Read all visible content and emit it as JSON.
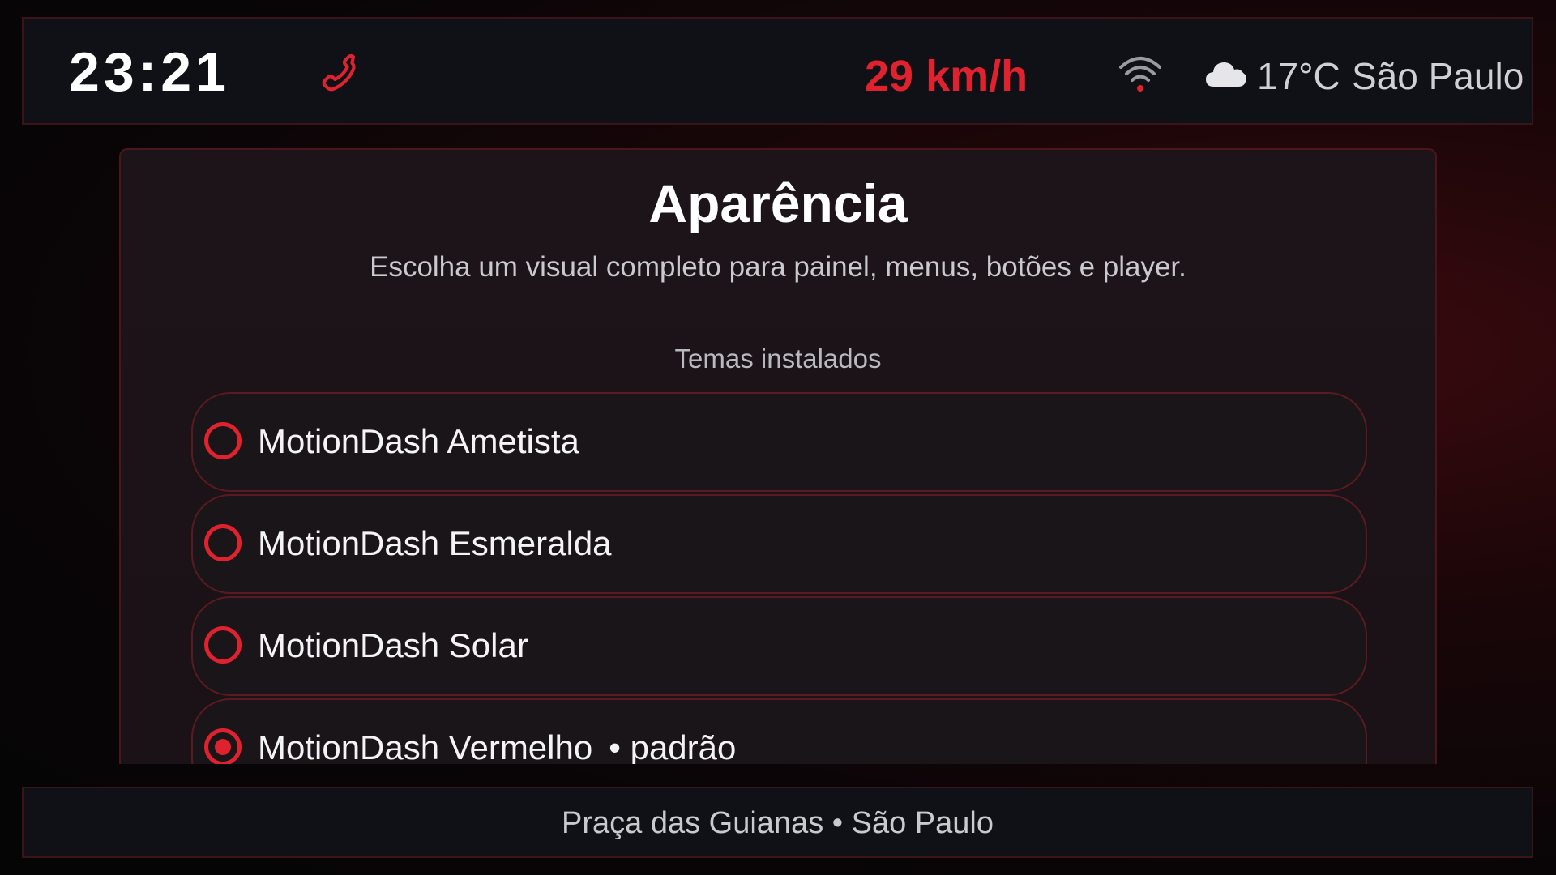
{
  "status_bar": {
    "time": "23:21",
    "speed": "29 km/h",
    "temperature": "17°C",
    "city": "São Paulo",
    "icons": [
      "phone-icon",
      "wifi-icon",
      "cloud-icon"
    ],
    "accent_color": "#e0222e"
  },
  "appearance": {
    "title": "Aparência",
    "subtitle": "Escolha um visual completo para painel, menus, botões e player.",
    "section_label": "Temas instalados",
    "themes": [
      {
        "name": "MotionDash Ametista",
        "selected": false,
        "tag": ""
      },
      {
        "name": "MotionDash Esmeralda",
        "selected": false,
        "tag": ""
      },
      {
        "name": "MotionDash Solar",
        "selected": false,
        "tag": ""
      },
      {
        "name": "MotionDash Vermelho",
        "selected": true,
        "tag": "• padrão"
      }
    ]
  },
  "bottom_bar": {
    "location": "Praça das Guianas • São Paulo"
  }
}
